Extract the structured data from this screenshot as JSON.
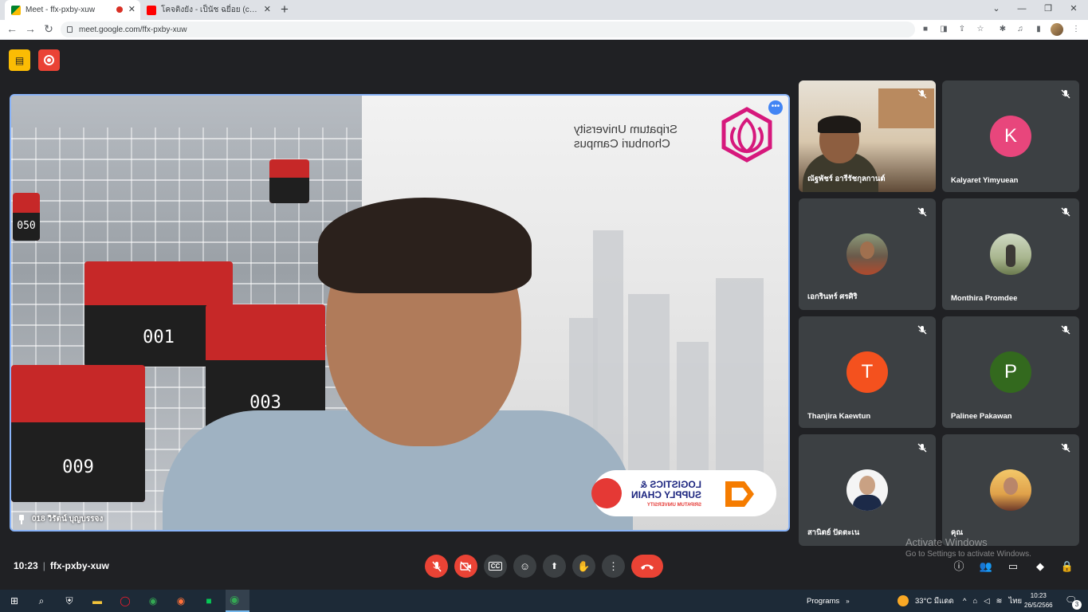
{
  "browser": {
    "tabs": [
      {
        "title": "Meet - ffx-pxby-xuw",
        "recording": true
      },
      {
        "title": "โคจติงยัง - เป็นัช ฉยี่อย (covered by ..."
      }
    ],
    "new_tab_symbol": "+",
    "url": "meet.google.com/ffx-pxby-xuw"
  },
  "meeting": {
    "time": "10:23",
    "separator": "|",
    "code": "ffx-pxby-xuw",
    "presenter_name": "018 วิรัตน์ บุญบรรจง",
    "slide": {
      "university_line1": "Sripatum University",
      "university_line2": "Chonburi Campus",
      "badge_line1": "LOGISTICS &",
      "badge_line2": "SUPPLY CHAIN",
      "badge_line3": "SRIPATUM UNIVERSITY",
      "robot_numbers": [
        "050",
        "001",
        "001",
        "003",
        "009"
      ]
    },
    "participants": [
      {
        "name": "ณัฐพัชร์ อารีรัชกุลกานต์",
        "type": "video",
        "muted": true
      },
      {
        "name": "Kalyaret Yimyuean",
        "type": "letter",
        "letter": "K",
        "color": "#e8467c",
        "muted": true
      },
      {
        "name": "เอกรินทร์ ศรศิริ",
        "type": "photo",
        "muted": true
      },
      {
        "name": "Monthira Promdee",
        "type": "photo",
        "muted": true
      },
      {
        "name": "Thanjira Kaewtun",
        "type": "letter",
        "letter": "T",
        "color": "#f4511e",
        "muted": true
      },
      {
        "name": "Palinee Pakawan",
        "type": "letter",
        "letter": "P",
        "color": "#33691e",
        "muted": true
      },
      {
        "name": "สานิตย์ ปัดตะเน",
        "type": "photo",
        "muted": true
      },
      {
        "name": "คุณ",
        "type": "photo",
        "muted": true
      }
    ]
  },
  "watermark": {
    "line1": "Activate Windows",
    "line2": "Go to Settings to activate Windows."
  },
  "taskbar": {
    "programs_label": "Programs",
    "weather": "33°C  มีแดด",
    "language": "ไทย",
    "clock_time": "10:23",
    "clock_date": "26/5/2566",
    "notifications": "3"
  }
}
